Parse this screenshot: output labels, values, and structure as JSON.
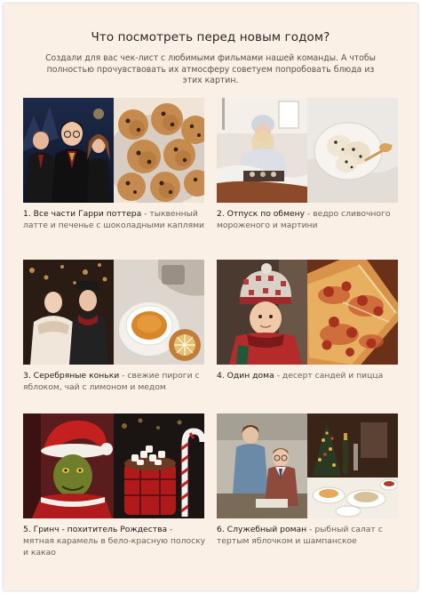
{
  "header": {
    "title": "Что посмотреть перед новым годом?",
    "subtitle": "Создали для вас чек-лист с любимыми фильмами нашей команды. А чтобы полностью прочувствовать их атмосферу советуем попробовать блюда из этих картин."
  },
  "items": [
    {
      "film": "1. Все части Гарри поттера",
      "separator": " - ",
      "food": "тыквенный латте и печенье с шоколадными каплями"
    },
    {
      "film": "2. Отпуск по обмену",
      "separator": " - ",
      "food": "ведро сливочного мороженого и мартини"
    },
    {
      "film": "3. Серебряные коньки",
      "separator": " - ",
      "food": "свежие пироги с яблоком, чай с лимоном и медом"
    },
    {
      "film": "4. Один дома",
      "separator": " - ",
      "food": "десерт сандей и пицца"
    },
    {
      "film": "5. Гринч - похититель Рождества",
      "separator": " - ",
      "food": "мятная карамель в бело-красную полоску и какао"
    },
    {
      "film": "6. Служебный роман",
      "separator": " - ",
      "food": "рыбный салат с тертым яблочком и шампанское"
    }
  ],
  "colors": {
    "page_background": "#fbf0e6",
    "title_text": "#2a2522",
    "body_text": "#6a5f58"
  }
}
